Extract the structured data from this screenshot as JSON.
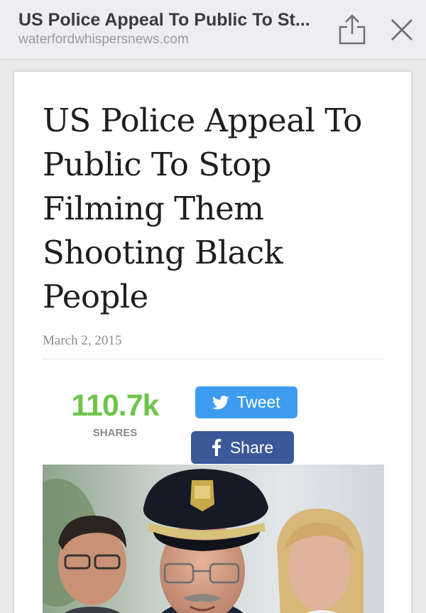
{
  "reader_bar": {
    "title": "US Police Appeal To Public To St...",
    "domain": "waterfordwhispersnews.com",
    "share_icon": "share-icon",
    "close_icon": "close-icon"
  },
  "article": {
    "headline": "US Police Appeal To Public To Stop Filming Them Shooting Black People",
    "date": "March 2, 2015"
  },
  "social": {
    "share_count": "110.7k",
    "share_caption": "SHARES",
    "tweet_label": "Tweet",
    "facebook_label": "Share",
    "twitter_icon": "twitter-bird-icon",
    "facebook_icon": "facebook-f-icon"
  },
  "colors": {
    "share_count": "#6ec44b",
    "tweet_button": "#3d9cf0",
    "facebook_button": "#3b5998"
  }
}
